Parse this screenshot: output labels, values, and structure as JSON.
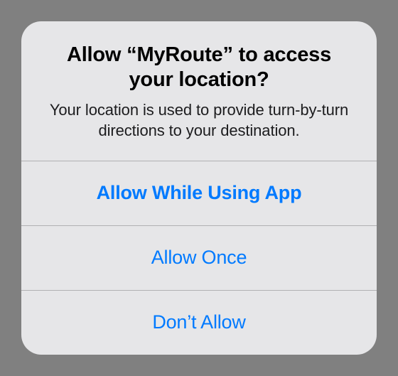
{
  "dialog": {
    "title": "Allow “MyRoute” to access your location?",
    "message": "Your location is used to provide turn-by-turn directions to your destination.",
    "buttons": {
      "allow_while_using": "Allow While Using App",
      "allow_once": "Allow Once",
      "dont_allow": "Don’t Allow"
    }
  },
  "colors": {
    "link": "#007aff",
    "background": "#e6e6e8",
    "separator": "#b0b0b2"
  }
}
